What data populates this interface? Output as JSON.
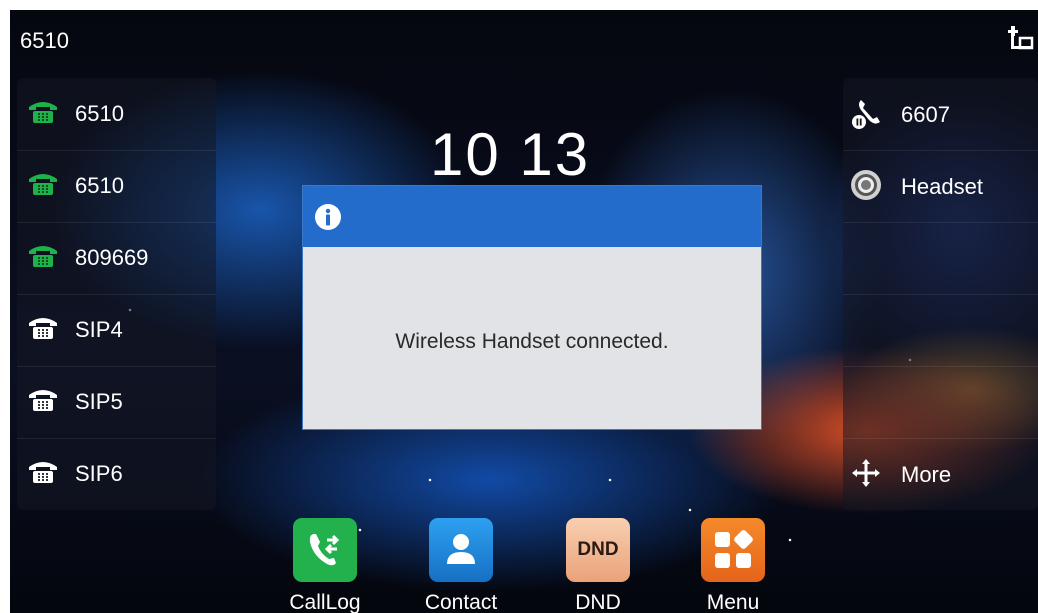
{
  "status_bar": {
    "title": "6510",
    "network_icon": "network-icon"
  },
  "clock": {
    "time": "10 13"
  },
  "line_keys": [
    {
      "label": "6510",
      "icon": "phone-registered-icon",
      "color": "#1db34a"
    },
    {
      "label": "6510",
      "icon": "phone-registered-icon",
      "color": "#1db34a"
    },
    {
      "label": "809669",
      "icon": "phone-registered-icon",
      "color": "#1db34a"
    },
    {
      "label": "SIP4",
      "icon": "phone-icon",
      "color": "#ffffff"
    },
    {
      "label": "SIP5",
      "icon": "phone-icon",
      "color": "#ffffff"
    },
    {
      "label": "SIP6",
      "icon": "phone-icon",
      "color": "#ffffff"
    }
  ],
  "function_keys": [
    {
      "label": "6607",
      "icon": "blf-hold-icon"
    },
    {
      "label": "Headset",
      "icon": "headset-icon"
    },
    {
      "label": "",
      "icon": ""
    },
    {
      "label": "",
      "icon": ""
    },
    {
      "label": "",
      "icon": ""
    },
    {
      "label": "More",
      "icon": "more-arrows-icon"
    }
  ],
  "dialog": {
    "icon": "info-icon",
    "message": "Wireless Handset connected.",
    "header_color": "#236ccc"
  },
  "dock": [
    {
      "label": "CallLog",
      "icon": "calllog-icon",
      "color": "#22b14c"
    },
    {
      "label": "Contact",
      "icon": "contact-icon",
      "color": "#1e88d8"
    },
    {
      "label": "DND",
      "icon": "dnd-icon",
      "color": "#f2b895",
      "tile_text": "DND"
    },
    {
      "label": "Menu",
      "icon": "menu-icon",
      "color": "#f07a1c"
    }
  ]
}
